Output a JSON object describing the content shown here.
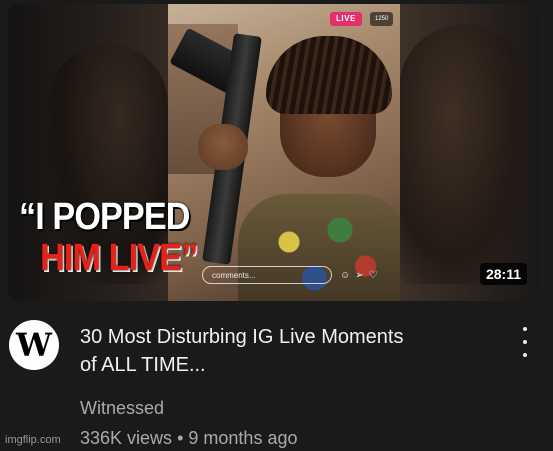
{
  "video": {
    "thumbnail": {
      "live_badge": "LIVE",
      "viewers_badge": "1250",
      "comment_placeholder": "comments...",
      "caption_line1": "“I POPPED",
      "caption_line2": "HIM LIVE”",
      "duration": "28:11",
      "icons": [
        "emoji-icon",
        "send-icon",
        "heart-icon"
      ]
    },
    "avatar_letter": "W",
    "title_line1": "30 Most Disturbing IG Live Moments",
    "title_line2": "of ALL TIME...",
    "channel": "Witnessed",
    "views": "336K views",
    "separator": "•",
    "age": "9 months ago"
  },
  "watermark": "imgflip.com",
  "colors": {
    "background": "#1a1a1a",
    "caption_red": "#e62117",
    "live_pink": "#e1306c",
    "secondary_text": "#aaaaaa"
  }
}
